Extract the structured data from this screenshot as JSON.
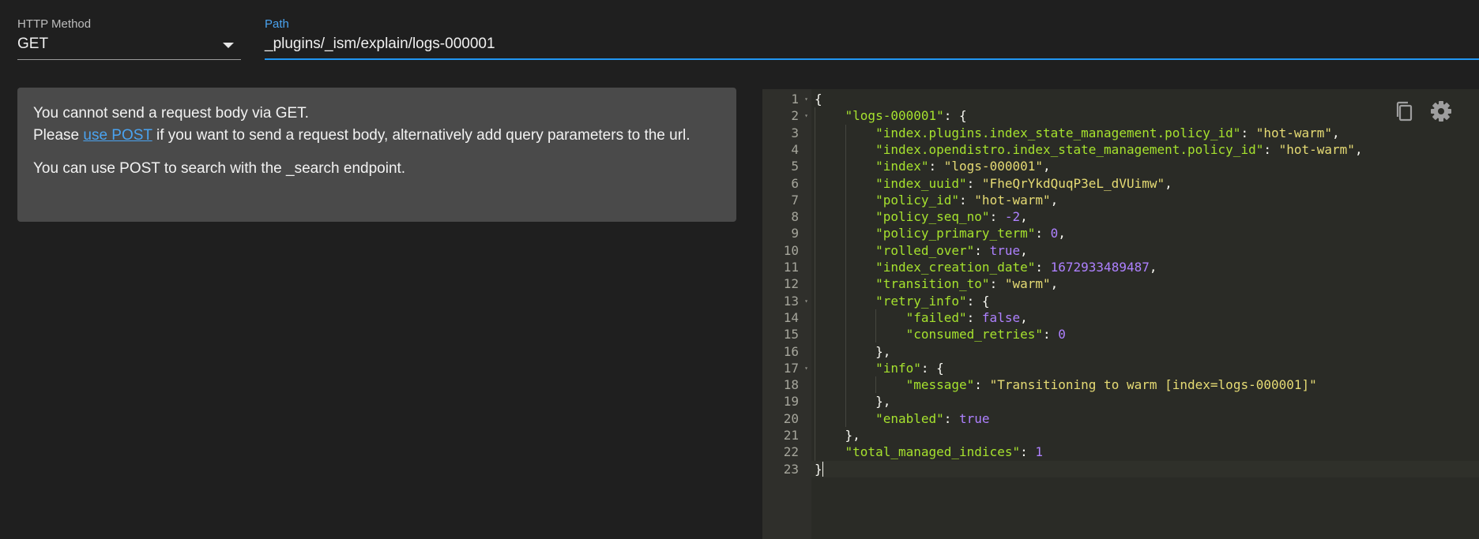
{
  "form": {
    "method_label": "HTTP Method",
    "method_value": "GET",
    "path_label": "Path",
    "path_value": "_plugins/_ism/explain/logs-000001"
  },
  "info": {
    "line1": "You cannot send a request body via GET.",
    "line2_prefix": "Please ",
    "line2_link": "use POST",
    "line2_suffix": " if you want to send a request body, alternatively add query parameters to the url.",
    "line3": "You can use POST to search with the _search endpoint."
  },
  "editor": {
    "toolbar": {
      "copy_icon": "copy-icon",
      "settings_icon": "gear-icon"
    },
    "colors": {
      "key": "#a6e22e",
      "string": "#e6db74",
      "number": "#ae81ff",
      "text": "#f8f8f2"
    },
    "lines": [
      {
        "n": "1",
        "fold": true,
        "indent": 0,
        "tokens": [
          [
            "p",
            "{"
          ]
        ]
      },
      {
        "n": "2",
        "fold": true,
        "indent": 1,
        "tokens": [
          [
            "k",
            "\"logs-000001\""
          ],
          [
            "p",
            ": {"
          ]
        ]
      },
      {
        "n": "3",
        "fold": false,
        "indent": 2,
        "tokens": [
          [
            "k",
            "\"index.plugins.index_state_management.policy_id\""
          ],
          [
            "p",
            ": "
          ],
          [
            "s",
            "\"hot-warm\""
          ],
          [
            "p",
            ","
          ]
        ]
      },
      {
        "n": "4",
        "fold": false,
        "indent": 2,
        "tokens": [
          [
            "k",
            "\"index.opendistro.index_state_management.policy_id\""
          ],
          [
            "p",
            ": "
          ],
          [
            "s",
            "\"hot-warm\""
          ],
          [
            "p",
            ","
          ]
        ]
      },
      {
        "n": "5",
        "fold": false,
        "indent": 2,
        "tokens": [
          [
            "k",
            "\"index\""
          ],
          [
            "p",
            ": "
          ],
          [
            "s",
            "\"logs-000001\""
          ],
          [
            "p",
            ","
          ]
        ]
      },
      {
        "n": "6",
        "fold": false,
        "indent": 2,
        "tokens": [
          [
            "k",
            "\"index_uuid\""
          ],
          [
            "p",
            ": "
          ],
          [
            "s",
            "\"FheQrYkdQuqP3eL_dVUimw\""
          ],
          [
            "p",
            ","
          ]
        ]
      },
      {
        "n": "7",
        "fold": false,
        "indent": 2,
        "tokens": [
          [
            "k",
            "\"policy_id\""
          ],
          [
            "p",
            ": "
          ],
          [
            "s",
            "\"hot-warm\""
          ],
          [
            "p",
            ","
          ]
        ]
      },
      {
        "n": "8",
        "fold": false,
        "indent": 2,
        "tokens": [
          [
            "k",
            "\"policy_seq_no\""
          ],
          [
            "p",
            ": "
          ],
          [
            "n",
            "-2"
          ],
          [
            "p",
            ","
          ]
        ]
      },
      {
        "n": "9",
        "fold": false,
        "indent": 2,
        "tokens": [
          [
            "k",
            "\"policy_primary_term\""
          ],
          [
            "p",
            ": "
          ],
          [
            "n",
            "0"
          ],
          [
            "p",
            ","
          ]
        ]
      },
      {
        "n": "10",
        "fold": false,
        "indent": 2,
        "tokens": [
          [
            "k",
            "\"rolled_over\""
          ],
          [
            "p",
            ": "
          ],
          [
            "n",
            "true"
          ],
          [
            "p",
            ","
          ]
        ]
      },
      {
        "n": "11",
        "fold": false,
        "indent": 2,
        "tokens": [
          [
            "k",
            "\"index_creation_date\""
          ],
          [
            "p",
            ": "
          ],
          [
            "n",
            "1672933489487"
          ],
          [
            "p",
            ","
          ]
        ]
      },
      {
        "n": "12",
        "fold": false,
        "indent": 2,
        "tokens": [
          [
            "k",
            "\"transition_to\""
          ],
          [
            "p",
            ": "
          ],
          [
            "s",
            "\"warm\""
          ],
          [
            "p",
            ","
          ]
        ]
      },
      {
        "n": "13",
        "fold": true,
        "indent": 2,
        "tokens": [
          [
            "k",
            "\"retry_info\""
          ],
          [
            "p",
            ": {"
          ]
        ]
      },
      {
        "n": "14",
        "fold": false,
        "indent": 3,
        "tokens": [
          [
            "k",
            "\"failed\""
          ],
          [
            "p",
            ": "
          ],
          [
            "n",
            "false"
          ],
          [
            "p",
            ","
          ]
        ]
      },
      {
        "n": "15",
        "fold": false,
        "indent": 3,
        "tokens": [
          [
            "k",
            "\"consumed_retries\""
          ],
          [
            "p",
            ": "
          ],
          [
            "n",
            "0"
          ]
        ]
      },
      {
        "n": "16",
        "fold": false,
        "indent": 2,
        "tokens": [
          [
            "p",
            "},"
          ]
        ]
      },
      {
        "n": "17",
        "fold": true,
        "indent": 2,
        "tokens": [
          [
            "k",
            "\"info\""
          ],
          [
            "p",
            ": {"
          ]
        ]
      },
      {
        "n": "18",
        "fold": false,
        "indent": 3,
        "tokens": [
          [
            "k",
            "\"message\""
          ],
          [
            "p",
            ": "
          ],
          [
            "s",
            "\"Transitioning to warm [index=logs-000001]\""
          ]
        ]
      },
      {
        "n": "19",
        "fold": false,
        "indent": 2,
        "tokens": [
          [
            "p",
            "},"
          ]
        ]
      },
      {
        "n": "20",
        "fold": false,
        "indent": 2,
        "tokens": [
          [
            "k",
            "\"enabled\""
          ],
          [
            "p",
            ": "
          ],
          [
            "n",
            "true"
          ]
        ]
      },
      {
        "n": "21",
        "fold": false,
        "indent": 1,
        "tokens": [
          [
            "p",
            "},"
          ]
        ]
      },
      {
        "n": "22",
        "fold": false,
        "indent": 1,
        "tokens": [
          [
            "k",
            "\"total_managed_indices\""
          ],
          [
            "p",
            ": "
          ],
          [
            "n",
            "1"
          ]
        ]
      },
      {
        "n": "23",
        "fold": false,
        "indent": 0,
        "tokens": [
          [
            "p",
            "}"
          ]
        ]
      }
    ]
  }
}
